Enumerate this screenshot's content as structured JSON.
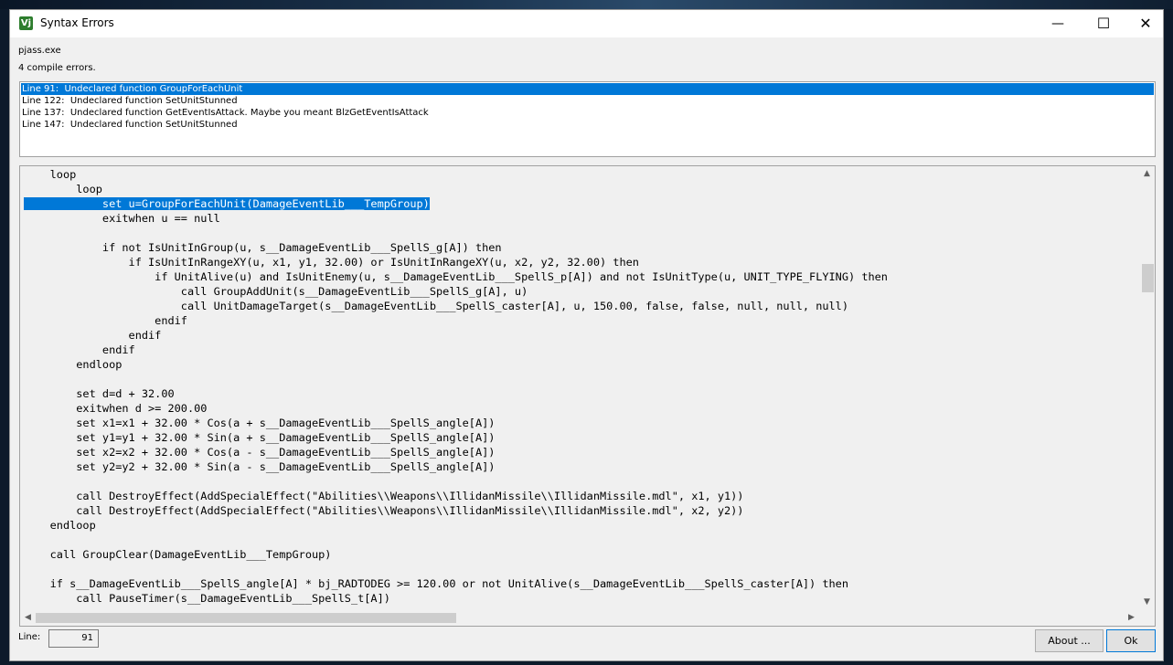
{
  "window": {
    "title": "Syntax Errors",
    "icon_text": "Vj",
    "minimize": "—",
    "maximize": "☐",
    "close": "✕"
  },
  "exe_name": "pjass.exe",
  "error_count": "4 compile errors.",
  "errors": [
    "Line 91:  Undeclared function GroupForEachUnit",
    "Line 122:  Undeclared function SetUnitStunned",
    "Line 137:  Undeclared function GetEventIsAttack. Maybe you meant BlzGetEventIsAttack",
    "Line 147:  Undeclared function SetUnitStunned"
  ],
  "code_lines": [
    "    loop",
    "        loop",
    "            set u=GroupForEachUnit(DamageEventLib___TempGroup)",
    "            exitwhen u == null",
    "",
    "            if not IsUnitInGroup(u, s__DamageEventLib___SpellS_g[A]) then",
    "                if IsUnitInRangeXY(u, x1, y1, 32.00) or IsUnitInRangeXY(u, x2, y2, 32.00) then",
    "                    if UnitAlive(u) and IsUnitEnemy(u, s__DamageEventLib___SpellS_p[A]) and not IsUnitType(u, UNIT_TYPE_FLYING) then",
    "                        call GroupAddUnit(s__DamageEventLib___SpellS_g[A], u)",
    "                        call UnitDamageTarget(s__DamageEventLib___SpellS_caster[A], u, 150.00, false, false, null, null, null)",
    "                    endif",
    "                endif",
    "            endif",
    "        endloop",
    "",
    "        set d=d + 32.00",
    "        exitwhen d >= 200.00",
    "        set x1=x1 + 32.00 * Cos(a + s__DamageEventLib___SpellS_angle[A])",
    "        set y1=y1 + 32.00 * Sin(a + s__DamageEventLib___SpellS_angle[A])",
    "        set x2=x2 + 32.00 * Cos(a - s__DamageEventLib___SpellS_angle[A])",
    "        set y2=y2 + 32.00 * Sin(a - s__DamageEventLib___SpellS_angle[A])",
    "",
    "        call DestroyEffect(AddSpecialEffect(\"Abilities\\\\Weapons\\\\IllidanMissile\\\\IllidanMissile.mdl\", x1, y1))",
    "        call DestroyEffect(AddSpecialEffect(\"Abilities\\\\Weapons\\\\IllidanMissile\\\\IllidanMissile.mdl\", x2, y2))",
    "    endloop",
    "",
    "    call GroupClear(DamageEventLib___TempGroup)",
    "",
    "    if s__DamageEventLib___SpellS_angle[A] * bj_RADTODEG >= 120.00 or not UnitAlive(s__DamageEventLib___SpellS_caster[A]) then",
    "        call PauseTimer(s__DamageEventLib___SpellS_t[A])"
  ],
  "highlighted_line_index": 2,
  "line_label": "Line:",
  "line_value": "91",
  "buttons": {
    "about": "About ...",
    "ok": "Ok"
  },
  "scroll_arrows": {
    "up": "▲",
    "down": "▼",
    "left": "◀",
    "right": "▶"
  },
  "colors": {
    "selection": "#0078d7",
    "icon_bg": "#2d7d2d"
  }
}
